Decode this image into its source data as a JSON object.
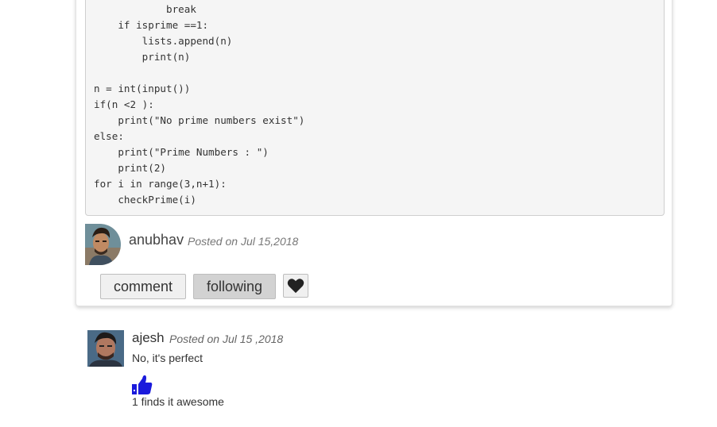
{
  "code": {
    "lines": [
      "            break",
      "    if isprime ==1:",
      "        lists.append(n)",
      "        print(n)",
      "",
      "n = int(input())",
      "if(n <2 ):",
      "    print(\"No prime numbers exist\")",
      "else:",
      "    print(\"Prime Numbers : \")",
      "    print(2)",
      "for i in range(3,n+1):",
      "    checkPrime(i)"
    ]
  },
  "post": {
    "author": "anubhav",
    "posted_on": "Posted on Jul 15,2018",
    "comment_label": "comment",
    "following_label": "following",
    "heart_icon": "heart-icon"
  },
  "comment": {
    "author": "ajesh",
    "posted_on": "Posted on Jul 15 ,2018",
    "text": "No, it's perfect",
    "like_icon": "thumbs-up-icon",
    "like_text": "1 finds it awesome",
    "like_color": "#1a1adc"
  }
}
